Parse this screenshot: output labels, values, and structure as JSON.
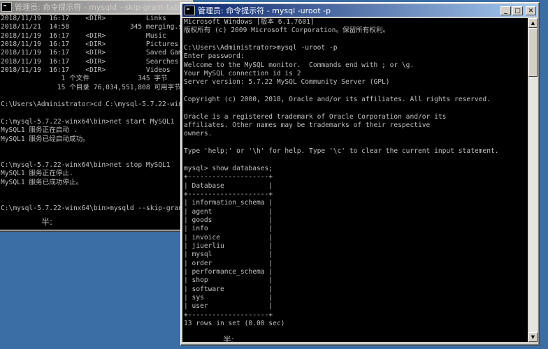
{
  "back_window": {
    "title": "管理员: 命令提示符 - mysqld  --skip-grant-tables",
    "ime_label": "半:",
    "lines": [
      "2018/11/19  16:17    <DIR>          Links",
      "2018/11/21  14:58               345 merging.sql",
      "2018/11/19  16:17    <DIR>          Music",
      "2018/11/19  16:17    <DIR>          Pictures",
      "2018/11/19  16:17    <DIR>          Saved Games",
      "2018/11/19  16:17    <DIR>          Searches",
      "2018/11/19  16:17    <DIR>          Videos",
      "               1 个文件            345 字节",
      "              15 个目录 76,034,551,808 可用字节",
      "",
      "C:\\Users\\Administrator>cd C:\\mysql-5.7.22-winx64\\bin",
      "",
      "C:\\mysql-5.7.22-winx64\\bin>net start MySQL1",
      "MySQL1 服务正在启动 .",
      "MySQL1 服务已经启动成功。",
      "",
      "",
      "C:\\mysql-5.7.22-winx64\\bin>net stop MySQL1",
      "MySQL1 服务正在停止.",
      "MySQL1 服务已成功停止。",
      "",
      "",
      "C:\\mysql-5.7.22-winx64\\bin>mysqld --skip-grant-tables"
    ]
  },
  "front_window": {
    "title": "管理员: 命令提示符 - mysql  -uroot -p",
    "ime_label": "半:",
    "lines": [
      "Microsoft Windows [版本 6.1.7601]",
      "版权所有 (c) 2009 Microsoft Corporation。保留所有权利。",
      "",
      "C:\\Users\\Administrator>mysql -uroot -p",
      "Enter password:",
      "Welcome to the MySQL monitor.  Commands end with ; or \\g.",
      "Your MySQL connection id is 2",
      "Server version: 5.7.22 MySQL Community Server (GPL)",
      "",
      "Copyright (c) 2000, 2018, Oracle and/or its affiliates. All rights reserved.",
      "",
      "Oracle is a registered trademark of Oracle Corporation and/or its",
      "affiliates. Other names may be trademarks of their respective",
      "owners.",
      "",
      "Type 'help;' or '\\h' for help. Type '\\c' to clear the current input statement.",
      "",
      "mysql> show databases;",
      "+--------------------+",
      "| Database           |",
      "+--------------------+",
      "| information_schema |",
      "| agent              |",
      "| goods              |",
      "| info               |",
      "| invoice            |",
      "| jiuerliu           |",
      "| mysql              |",
      "| order              |",
      "| performance_schema |",
      "| shop               |",
      "| software           |",
      "| sys                |",
      "| user               |",
      "+--------------------+",
      "13 rows in set (0.00 sec)"
    ]
  },
  "icons": {
    "system_menu": "cmd-icon",
    "minimize": "minimize-icon",
    "maximize": "maximize-icon",
    "close": "close-icon",
    "scroll_up": "scroll-up-arrow-icon",
    "scroll_down": "scroll-down-arrow-icon"
  },
  "colors": {
    "desktop": "#3a6ea5",
    "console_bg": "#000000",
    "console_fg": "#c0c0c0",
    "active_title": "#0a246a",
    "inactive_title": "#808080"
  }
}
